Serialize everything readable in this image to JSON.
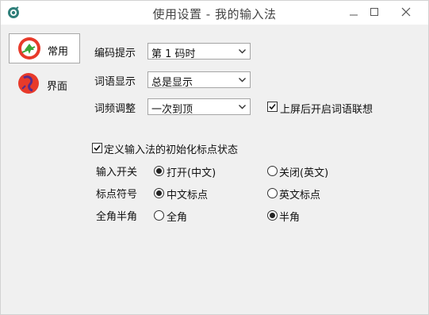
{
  "window": {
    "title": "使用设置 - 我的输入法"
  },
  "sidebar": {
    "items": [
      {
        "label": "常用",
        "icon": "general-icon"
      },
      {
        "label": "界面",
        "icon": "appearance-icon"
      }
    ]
  },
  "settings": {
    "code_hint": {
      "label": "编码提示",
      "value": "第 1 码时"
    },
    "word_display": {
      "label": "词语显示",
      "value": "总是显示"
    },
    "freq_adjust": {
      "label": "词频调整",
      "value": "一次到顶"
    },
    "association": {
      "label": "上屏后开启词语联想",
      "checked": true
    }
  },
  "init_state": {
    "checkbox_label": "定义输入法的初始化标点状态",
    "checked": true,
    "rows": [
      {
        "label": "输入开关",
        "option1": "打开(中文)",
        "option2": "关闭(英文)",
        "selected": 1
      },
      {
        "label": "标点符号",
        "option1": "中文标点",
        "option2": "英文标点",
        "selected": 1
      },
      {
        "label": "全角半角",
        "option1": "全角",
        "option2": "半角",
        "selected": 2
      }
    ]
  },
  "colors": {
    "active_border": "#a8a8a8",
    "background": "#f0f0f0",
    "icon_red": "#e83a2a",
    "icon_green": "#3aa43a"
  }
}
